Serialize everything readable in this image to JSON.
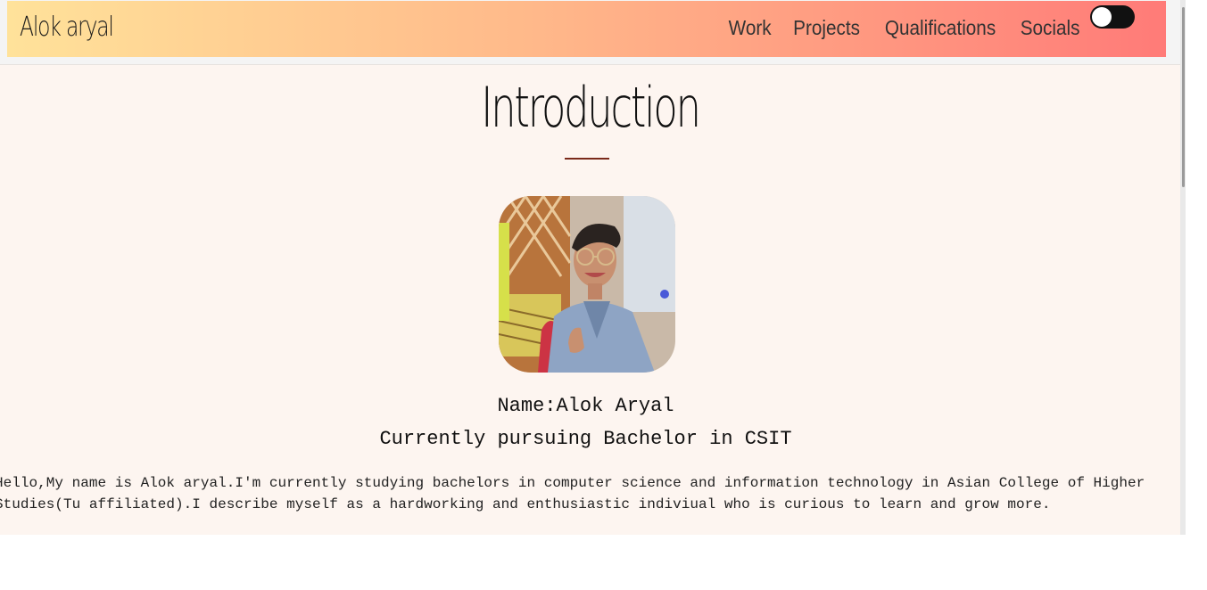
{
  "navbar": {
    "brand": "Alok aryal",
    "links": [
      "Work",
      "Projects",
      "Qualifications",
      "Socials"
    ],
    "theme_toggle": {
      "state": "off"
    }
  },
  "intro": {
    "title": "Introduction",
    "name_line": "Name:Alok Aryal",
    "subtitle": "Currently pursuing Bachelor in CSIT",
    "bio_lines": [
      "Hello,My name is Alok aryal.I'm currently studying bachelors in computer science and information technology in Asian College of Higher",
      "Studies(Tu affiliated).I describe myself as a hardworking and enthusiastic indiviual who is curious to learn and grow more."
    ]
  },
  "colors": {
    "navbar_gradient_start": "#ffe29a",
    "navbar_gradient_end": "#ff7b78",
    "page_background": "#fdf5f0",
    "divider": "#7a2a1a"
  }
}
